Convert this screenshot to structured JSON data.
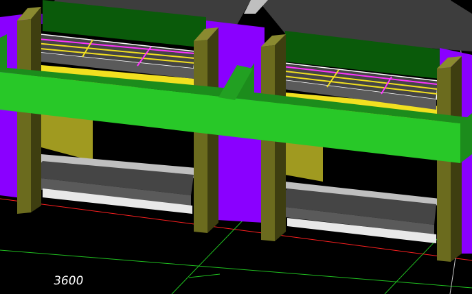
{
  "viewport": {
    "background": "#000000",
    "dimension_label": "3600"
  },
  "colors": {
    "wall": "#8a00ff",
    "wall_dark": "#5a00b0",
    "beam": "#28c828",
    "beam_dark": "#1c8c1c",
    "post": "#6b6b1e",
    "post_dark": "#3e3e10",
    "shelf": "#454545",
    "shelf_light": "#e8e8e8",
    "grid_yellow": "#f2e020",
    "grid_magenta": "#ff33ff",
    "canopy": "#0a5a0a",
    "roof": "#3d3d3d",
    "axis_red": "#ff2020",
    "axis_green": "#20c020"
  }
}
